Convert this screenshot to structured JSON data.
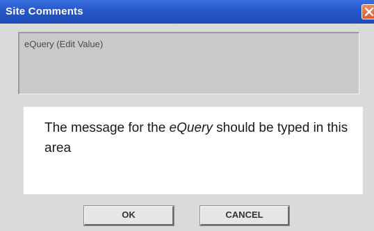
{
  "window": {
    "title": "Site Comments",
    "close_icon": "close-icon"
  },
  "query_field": {
    "value": "eQuery (Edit Value)"
  },
  "message_area": {
    "text_before": "The message for the ",
    "text_emphasis": "eQuery",
    "text_after": " should be typed in this area"
  },
  "buttons": {
    "ok_label": "OK",
    "cancel_label": "CANCEL"
  },
  "colors": {
    "titlebar": "#2656c8",
    "close_button": "#e05a30",
    "background": "#dadada",
    "field": "#c9c9c9"
  }
}
